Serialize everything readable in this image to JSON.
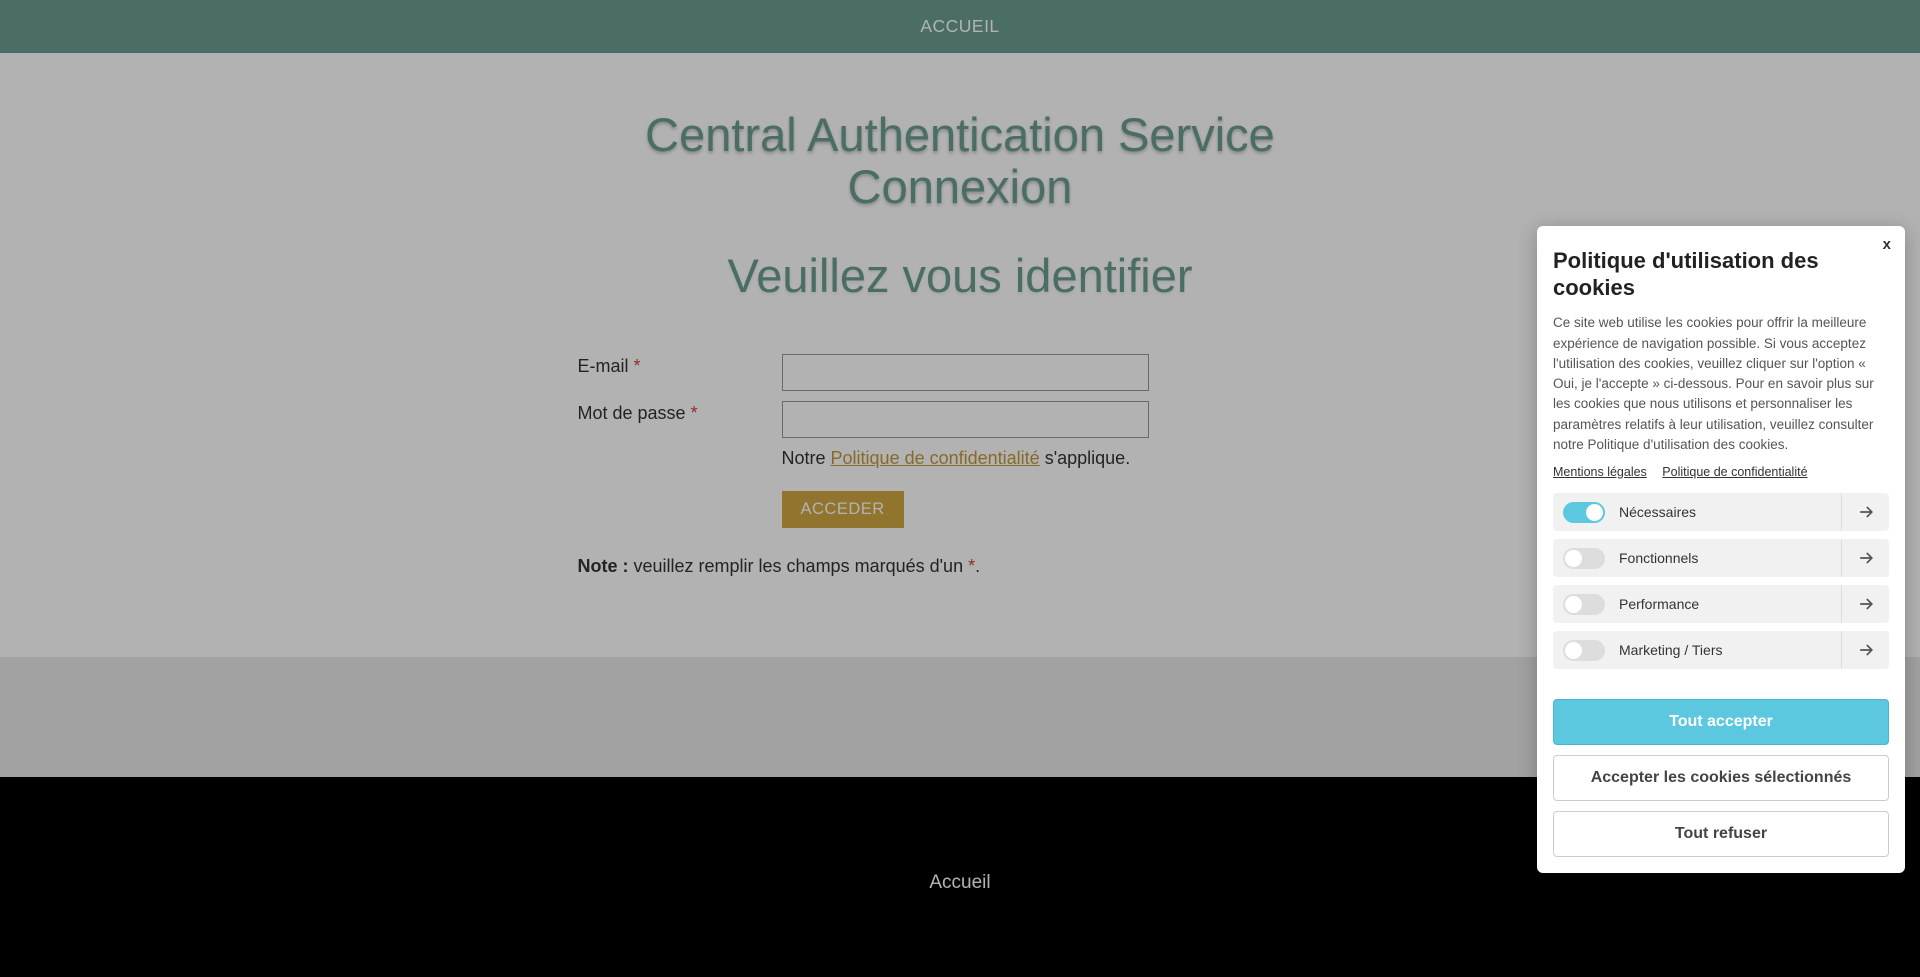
{
  "nav": {
    "home": "ACCUEIL"
  },
  "heading": {
    "line1": "Central Authentication Service",
    "line2": "Connexion",
    "sub": "Veuillez vous identifier"
  },
  "form": {
    "email_label": "E-mail ",
    "password_label": "Mot de passe ",
    "required": "*",
    "privacy_prefix": "Notre ",
    "privacy_link": "Politique de confidentialité",
    "privacy_suffix": " s'applique.",
    "submit": "ACCEDER",
    "note_bold": "Note :",
    "note_text": " veuillez remplir les champs marqués d'un ",
    "note_end": "."
  },
  "footer": {
    "home": "Accueil"
  },
  "cookie": {
    "close": "x",
    "title": "Politique d'utilisation des cookies",
    "desc": "Ce site web utilise les cookies pour offrir la meilleure expérience de navigation possible. Si vous acceptez l'utilisation des cookies, veuillez cliquer sur l'option « Oui, je l'accepte » ci-dessous. Pour en savoir plus sur les cookies que nous utilisons et personnaliser les paramètres relatifs à leur utilisation, veuillez consulter notre Politique d'utilisation des cookies.",
    "legal1": "Mentions légales",
    "legal2": "Politique de confidentialité",
    "categories": [
      {
        "label": "Nécessaires",
        "on": true
      },
      {
        "label": "Fonctionnels",
        "on": false
      },
      {
        "label": "Performance",
        "on": false
      },
      {
        "label": "Marketing / Tiers",
        "on": false
      }
    ],
    "accept_all": "Tout accepter",
    "accept_selected": "Accepter les cookies sélectionnés",
    "reject_all": "Tout refuser"
  }
}
